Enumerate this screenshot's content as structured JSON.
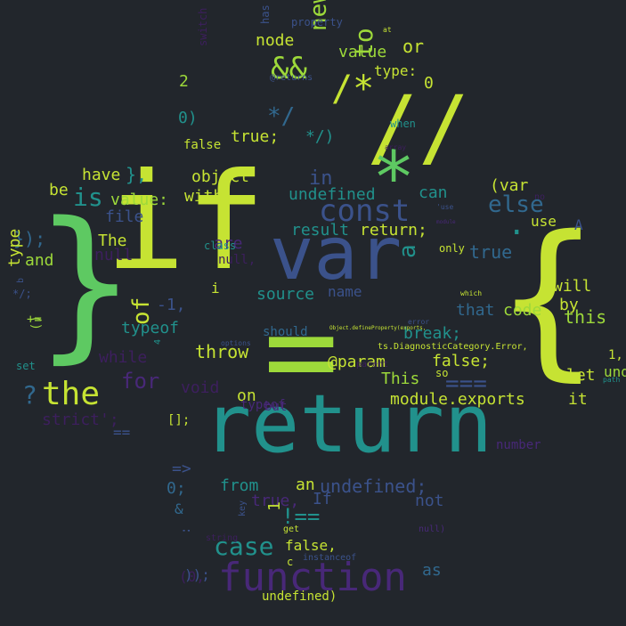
{
  "palette": {
    "background": "#22262c",
    "yellow": "#c6e333",
    "lime": "#9dd93a",
    "green": "#5ec962",
    "teal": "#21918c",
    "blue": "#31688e",
    "indigo": "#3b528b",
    "purple": "#482878",
    "deep": "#3d1f5e"
  },
  "words": [
    "if",
    "var",
    "=",
    "return",
    "}",
    "{",
    "//",
    "*",
    "const",
    "function",
    "the",
    "/*",
    "is",
    "else",
    "in",
    "of",
    "for",
    "case",
    "a",
    "&&",
    "new",
    "===",
    "!==",
    "this",
    "to",
    "value",
    "or",
    "type:",
    "0",
    "node",
    "2",
    "0)",
    "*/",
    "true;",
    "*/)",
    "false",
    "have",
    "},",
    "object",
    "value:",
    "with",
    "be",
    "undefined",
    "can",
    "(var",
    ".",
    "file",
    "are",
    "class",
    "result",
    "return;",
    "});",
    "The",
    "null",
    "and",
    "type",
    "typeof",
    "-1,",
    "i",
    "source",
    "name",
    "*/;",
    "()",
    "+=",
    "while",
    "throw",
    "void",
    "@param",
    "false;",
    "This",
    "module.exports",
    "on",
    "but",
    "?",
    "strict';",
    "==",
    "[];",
    "=>",
    "0;",
    "from",
    "an",
    "undefined;",
    "true,",
    "If",
    "not",
    "as",
    "false,",
    "c",
    "(0,",
    "));",
    "undefined)",
    "true",
    "code",
    "that",
    "break;",
    "by",
    "will",
    "undefined,",
    "let",
    "it",
    "1,",
    "so",
    "use",
    "A",
    "only",
    "has",
    "property",
    "at",
    "@returns",
    "when",
    "array",
    "switch",
    "should",
    "options",
    "error",
    "which",
    "ts.DiagnosticCategory.Error,",
    "Object.defineProperty(exports,",
    "parent",
    "path",
    "no",
    "get",
    "key",
    "string",
    "instanceof",
    "number",
    "&",
    "1",
    ":",
    "4",
    "b",
    "set",
    "'use",
    "module",
    "typeof",
    "null,",
    "null)",
    "exports"
  ]
}
